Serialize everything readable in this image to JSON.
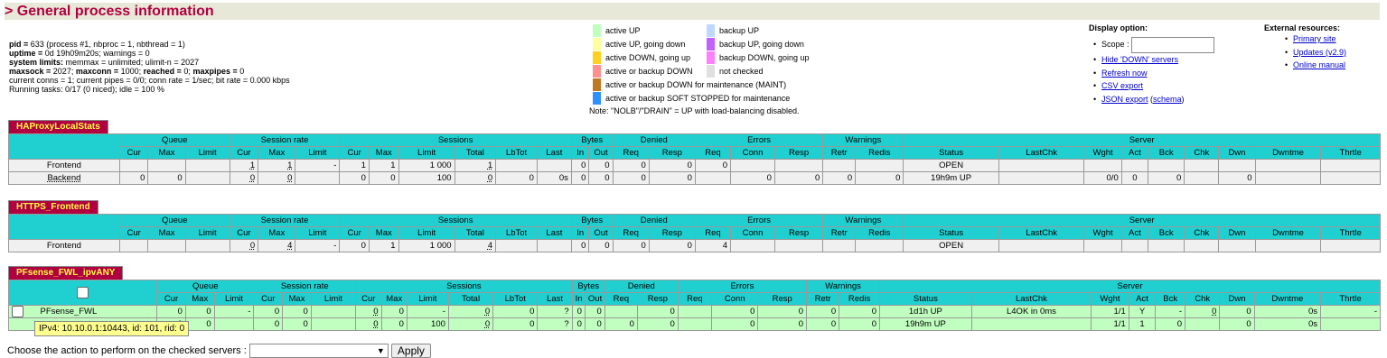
{
  "title": "> General process information",
  "info": {
    "l1a": "pid = ",
    "l1b": "633 (process #1, nbproc = 1, nbthread = 1)",
    "l2a": "uptime = ",
    "l2b": "0d 19h09m20s; warnings = 0",
    "l3a": "system limits:",
    "l3b": " memmax = unlimited; ulimit-n = 2027",
    "l4a": "maxsock = ",
    "l4b": "2027; ",
    "l4c": "maxconn = ",
    "l4d": "1000; ",
    "l4e": "reached = ",
    "l4f": "0; ",
    "l4g": "maxpipes = ",
    "l4h": "0",
    "l5": "current conns = 1; current pipes = 0/0; conn rate = 1/sec; bit rate = 0.000 kbps",
    "l6": "Running tasks: 0/17 (0 niced); idle = 100 %"
  },
  "legend": {
    "items": [
      {
        "label": "active UP",
        "color": "#c0ffc0"
      },
      {
        "label": "active UP, going down",
        "color": "#ffffa0"
      },
      {
        "label": "active DOWN, going up",
        "color": "#ffd020"
      },
      {
        "label": "active or backup DOWN",
        "color": "#ff9090"
      },
      {
        "label": "active or backup DOWN for maintenance (MAINT)",
        "color": "#c07820"
      },
      {
        "label": "active or backup SOFT STOPPED for maintenance",
        "color": "#3090ff"
      },
      {
        "label": "backup UP",
        "color": "#c0d8ff"
      },
      {
        "label": "backup UP, going down",
        "color": "#c060ff"
      },
      {
        "label": "backup DOWN, going up",
        "color": "#ff80ff"
      },
      {
        "label": "not checked",
        "color": "#e0e0e0"
      }
    ],
    "note": "Note: \"NOLB\"/\"DRAIN\" = UP with load-balancing disabled."
  },
  "display": {
    "title": "Display option:",
    "scope": "Scope :",
    "hide": "Hide 'DOWN' servers",
    "refresh": "Refresh now",
    "csv": "CSV export",
    "json": "JSON export",
    "schema": "schema"
  },
  "external": {
    "title": "External resources:",
    "primary": "Primary site",
    "updates": "Updates (v2.9)",
    "manual": "Online manual"
  },
  "groups": {
    "queue": "Queue",
    "srate": "Session rate",
    "sessions": "Sessions",
    "bytes": "Bytes",
    "denied": "Denied",
    "errors": "Errors",
    "warnings": "Warnings",
    "server": "Server"
  },
  "cols": [
    "Cur",
    "Max",
    "Limit",
    "Cur",
    "Max",
    "Limit",
    "Cur",
    "Max",
    "Limit",
    "Total",
    "LbTot",
    "Last",
    "In",
    "Out",
    "Req",
    "Resp",
    "Req",
    "Conn",
    "Resp",
    "Retr",
    "Redis",
    "Status",
    "LastChk",
    "Wght",
    "Act",
    "Bck",
    "Chk",
    "Dwn",
    "Dwntme",
    "Thrtle"
  ],
  "proxies": [
    {
      "name": "HAProxyLocalStats",
      "rows": [
        [
          "Frontend",
          "",
          "",
          "",
          "1",
          "1",
          "-",
          "1",
          "1",
          "1 000",
          "1",
          "",
          "",
          "0",
          "0",
          "0",
          "0",
          "0",
          "",
          "",
          "",
          "",
          "OPEN",
          "",
          "",
          "",
          "",
          "",
          "",
          "",
          ""
        ],
        [
          "Backend",
          "0",
          "0",
          "",
          "0",
          "0",
          "",
          "0",
          "0",
          "100",
          "0",
          "0",
          "0s",
          "0",
          "0",
          "0",
          "0",
          "",
          "0",
          "0",
          "0",
          "0",
          "19h9m UP",
          "",
          "0/0",
          "0",
          "0",
          "",
          "0",
          "",
          ""
        ]
      ]
    },
    {
      "name": "HTTPS_Frontend",
      "rows": [
        [
          "Frontend",
          "",
          "",
          "",
          "0",
          "4",
          "-",
          "0",
          "1",
          "1 000",
          "4",
          "",
          "",
          "0",
          "0",
          "0",
          "0",
          "4",
          "",
          "",
          "",
          "",
          "OPEN",
          "",
          "",
          "",
          "",
          "",
          "",
          "",
          ""
        ]
      ]
    },
    {
      "name": "PFsense_FWL_ipvANY",
      "rows": [
        [
          "PFsense_FWL",
          "0",
          "0",
          "-",
          "0",
          "0",
          "",
          "0",
          "0",
          "-",
          "0",
          "0",
          "?",
          "0",
          "0",
          "",
          "0",
          "",
          "0",
          "0",
          "0",
          "0",
          "1d1h UP",
          "L4OK in 0ms",
          "1/1",
          "Y",
          "-",
          "0",
          "0",
          "0s",
          "-"
        ],
        [
          "",
          "0",
          "0",
          "",
          "0",
          "0",
          "",
          "0",
          "0",
          "100",
          "0",
          "0",
          "?",
          "0",
          "0",
          "0",
          "0",
          "",
          "0",
          "0",
          "0",
          "0",
          "19h9m UP",
          "",
          "1/1",
          "1",
          "0",
          "",
          "0",
          "0s",
          ""
        ]
      ]
    }
  ],
  "tooltip": "IPv4: 10.10.0.1:10443, id: 101, rid: 0",
  "bottom": {
    "label": "Choose the action to perform on the checked servers :",
    "apply": "Apply"
  }
}
